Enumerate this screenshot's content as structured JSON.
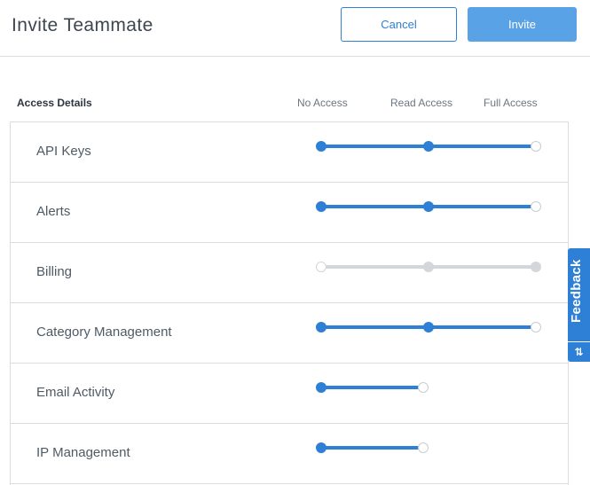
{
  "header": {
    "title": "Invite Teammate",
    "cancel_label": "Cancel",
    "invite_label": "Invite"
  },
  "access": {
    "section_title": "Access Details",
    "columns": [
      "No Access",
      "Read Access",
      "Full Access"
    ],
    "rows": [
      {
        "label": "API Keys",
        "level": "Read Access",
        "enabled": true,
        "levels_available": 3
      },
      {
        "label": "Alerts",
        "level": "Read Access",
        "enabled": true,
        "levels_available": 3
      },
      {
        "label": "Billing",
        "level": "Full Access",
        "enabled": false,
        "levels_available": 3
      },
      {
        "label": "Category Management",
        "level": "Read Access",
        "enabled": true,
        "levels_available": 3
      },
      {
        "label": "Email Activity",
        "level": "No Access",
        "enabled": true,
        "levels_available": 2
      },
      {
        "label": "IP Management",
        "level": "No Access",
        "enabled": true,
        "levels_available": 2
      }
    ]
  },
  "feedback": {
    "label": "Feedback",
    "icon": "sort-arrows-icon",
    "icon_glyph": "⇅"
  },
  "colors": {
    "accent": "#2e7fd6",
    "invite_button": "#5aa2e6",
    "disabled_track": "#d3d6da",
    "border": "#d9dde2"
  }
}
